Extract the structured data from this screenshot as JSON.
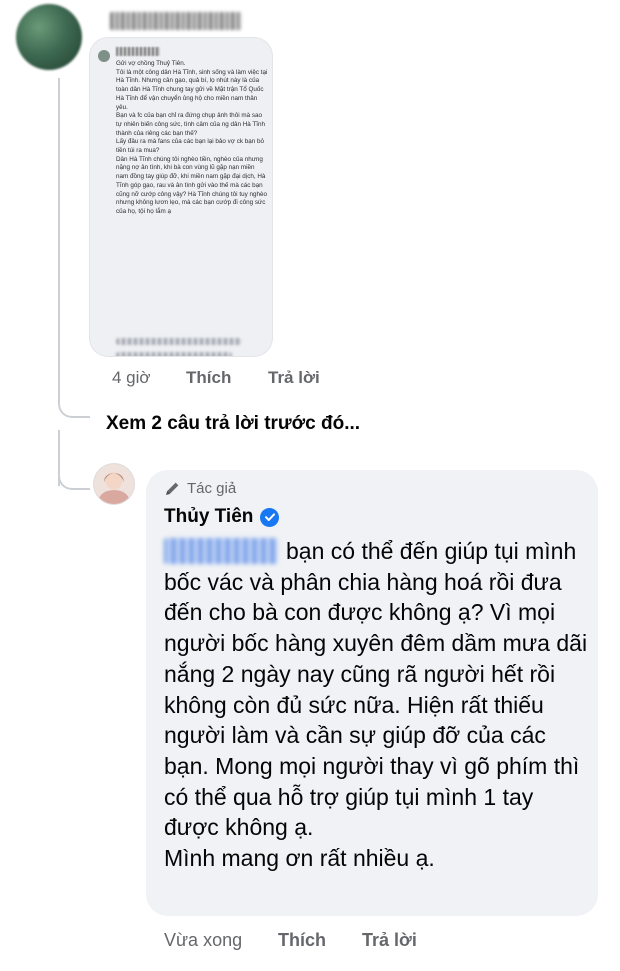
{
  "top_comment": {
    "screenshot_text": "Gửi vợ chồng Thuỷ Tiên.\nTôi là một công dân Hà Tĩnh, sinh sống và làm việc tại Hà Tĩnh. Nhưng cân gạo, quả bí, lọ nhút này là của toàn dân Hà Tĩnh chung tay gửi về Mặt trận Tổ Quốc Hà Tĩnh để vận chuyển ủng hộ cho miền nam thân yêu.\nBạn và fc của bạn chỉ ra đứng chụp ảnh thôi mà sao tự nhiên biến công sức, tình cảm của ng dân Hà Tĩnh thành của riêng các bạn thế?\nLấy đâu ra mà fans của các bạn lại bảo vợ ck bạn bỏ tiền túi ra mua?\nDân Hà Tĩnh chúng tôi nghèo tiền, nghèo của nhưng nặng nợ ân tình, khi bà con vùng lũ gặp nạn miền nam đồng tay giúp đỡ, khi miền nam gặp đại dịch, Hà Tĩnh góp gạo, rau và ân tình gửi vào thế mà các bạn cũng nỡ cướp công vậy? Hà Tĩnh chúng tôi tuy nghèo nhưng không lươn lẹo, mà các bạn cướp đi công sức của họ, tội họ lắm ạ",
    "time": "4 giờ",
    "like_label": "Thích",
    "reply_label": "Trả lời"
  },
  "see_previous_replies": "Xem 2 câu trả lời trước đó...",
  "reply": {
    "badge_label": "Tác giả",
    "author_name": "Thủy Tiên",
    "body": "bạn có thể đến giúp tụi mình bốc vác và phân chia hàng hoá rồi đưa đến cho bà con được không ạ? Vì mọi người bốc hàng xuyên đêm dầm mưa dãi nắng 2 ngày nay cũng rã người hết rồi không còn đủ sức nữa. Hiện rất thiếu người làm và cần sự giúp đỡ của các bạn. Mong mọi người thay vì gõ phím thì có thể qua hỗ trợ giúp tụi mình 1 tay được không ạ.\nMình mang ơn rất nhiều ạ.",
    "time": "Vừa xong",
    "like_label": "Thích",
    "reply_label": "Trả lời"
  },
  "colors": {
    "bubble_bg": "#f0f2f5",
    "meta_text": "#65676b",
    "verified_blue": "#1877f2"
  }
}
